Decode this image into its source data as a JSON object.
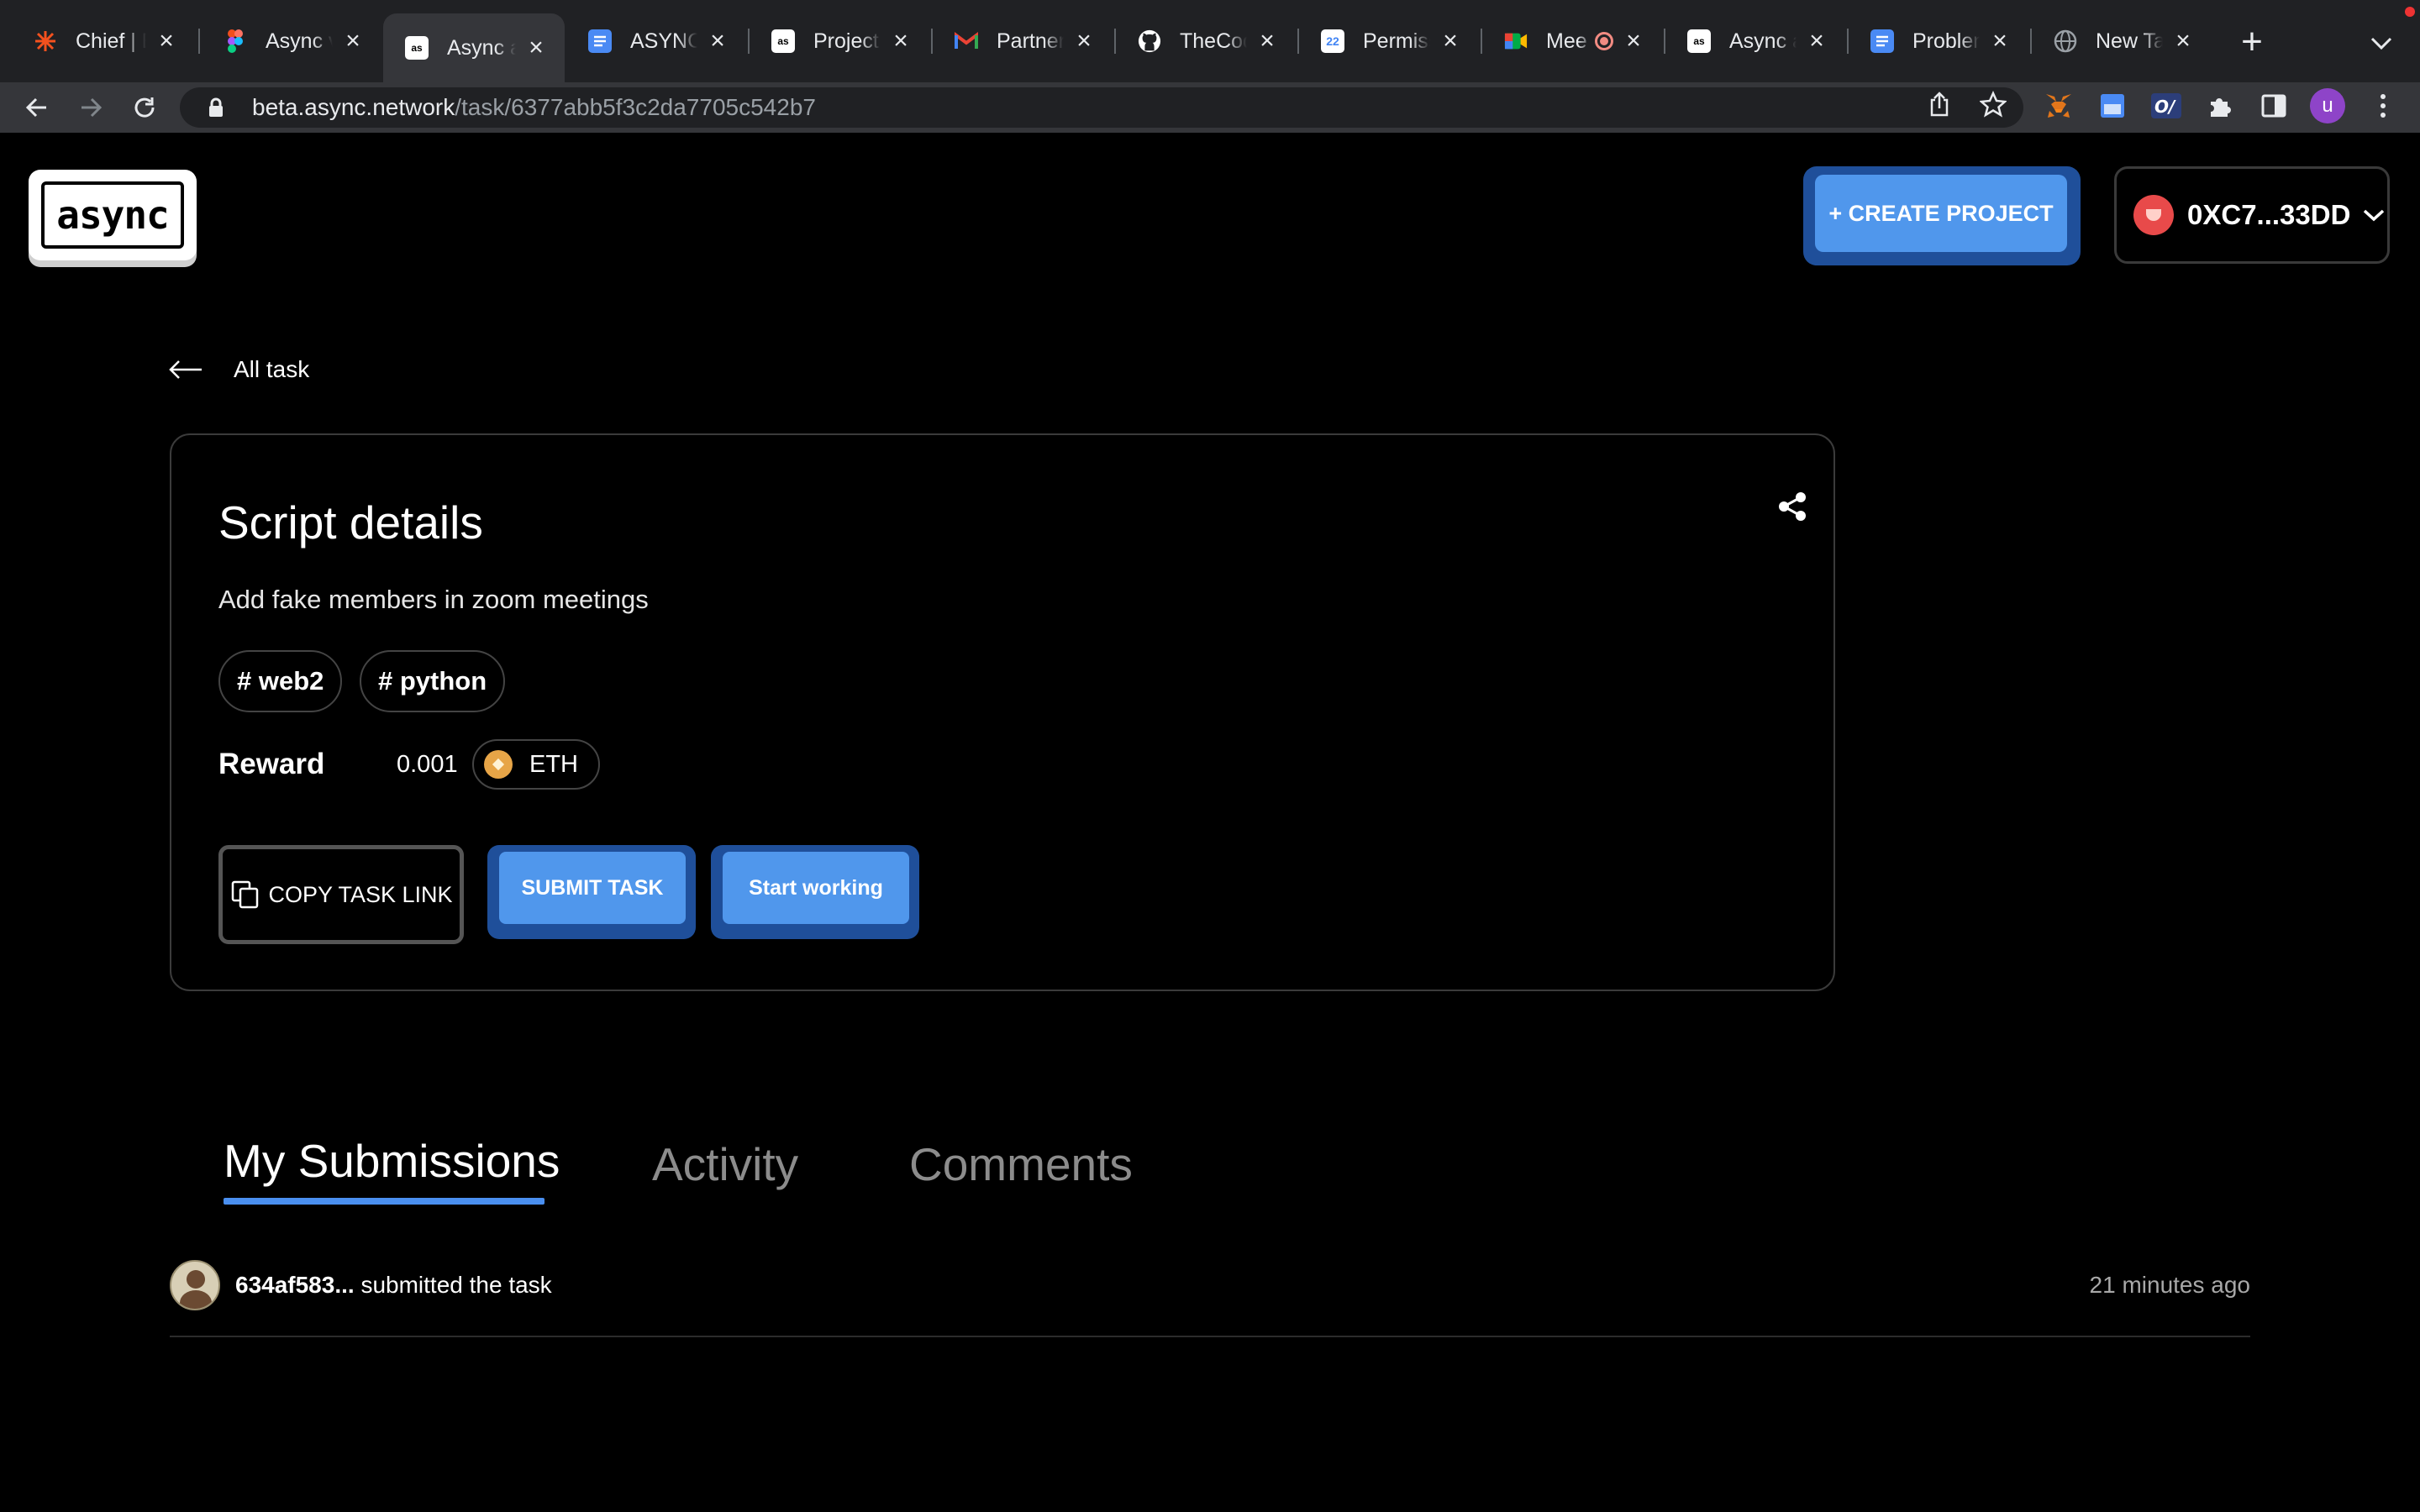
{
  "browser": {
    "tabs": [
      {
        "title": "Chief | E",
        "favicon": "burst-icon",
        "color": "#f4511e"
      },
      {
        "title": "Async v",
        "favicon": "figma-icon",
        "color": "#a259ff"
      },
      {
        "title": "Async a",
        "favicon": "async-icon",
        "color": "#ffffff",
        "active": true
      },
      {
        "title": "ASYNC",
        "favicon": "docs-icon",
        "color": "#4a8af4"
      },
      {
        "title": "Project",
        "favicon": "async-icon",
        "color": "#ffffff"
      },
      {
        "title": "Partners",
        "favicon": "gmail-icon",
        "color": "#ea4335"
      },
      {
        "title": "TheCod",
        "favicon": "github-icon",
        "color": "#ffffff"
      },
      {
        "title": "Permiss",
        "favicon": "calendar-icon",
        "color": "#4285f4"
      },
      {
        "title": "Mee",
        "favicon": "meet-icon",
        "color": "#00ac47",
        "recording": true
      },
      {
        "title": "Async a",
        "favicon": "async-icon",
        "color": "#ffffff"
      },
      {
        "title": "Problem",
        "favicon": "docs-icon",
        "color": "#4a8af4"
      },
      {
        "title": "New Tab",
        "favicon": "globe-icon",
        "color": "#9aa0a6"
      }
    ],
    "url_host": "beta.async.network",
    "url_path": "/task/6377abb5f3c2da7705c542b7",
    "profile_initial": "u"
  },
  "header": {
    "logo_text": "async",
    "create_label": "+ CREATE PROJECT",
    "wallet_label": "0XC7...33DD"
  },
  "nav": {
    "back_label": "All task"
  },
  "task": {
    "title": "Script details",
    "description": "Add fake members in zoom meetings",
    "tags": [
      "# web2",
      "# python"
    ],
    "reward_label": "Reward",
    "reward_value": "0.001",
    "reward_token": "ETH",
    "copy_label": "COPY TASK LINK",
    "submit_label": "SUBMIT TASK",
    "start_label": "Start working"
  },
  "page_tabs": [
    "My Submissions",
    "Activity",
    "Comments"
  ],
  "submissions": [
    {
      "user": "634af583...",
      "action": "submitted the task",
      "time": "21 minutes ago"
    }
  ],
  "colors": {
    "accent": "#5097ec",
    "accent_shadow": "#1f4f9a",
    "background": "#000000"
  }
}
